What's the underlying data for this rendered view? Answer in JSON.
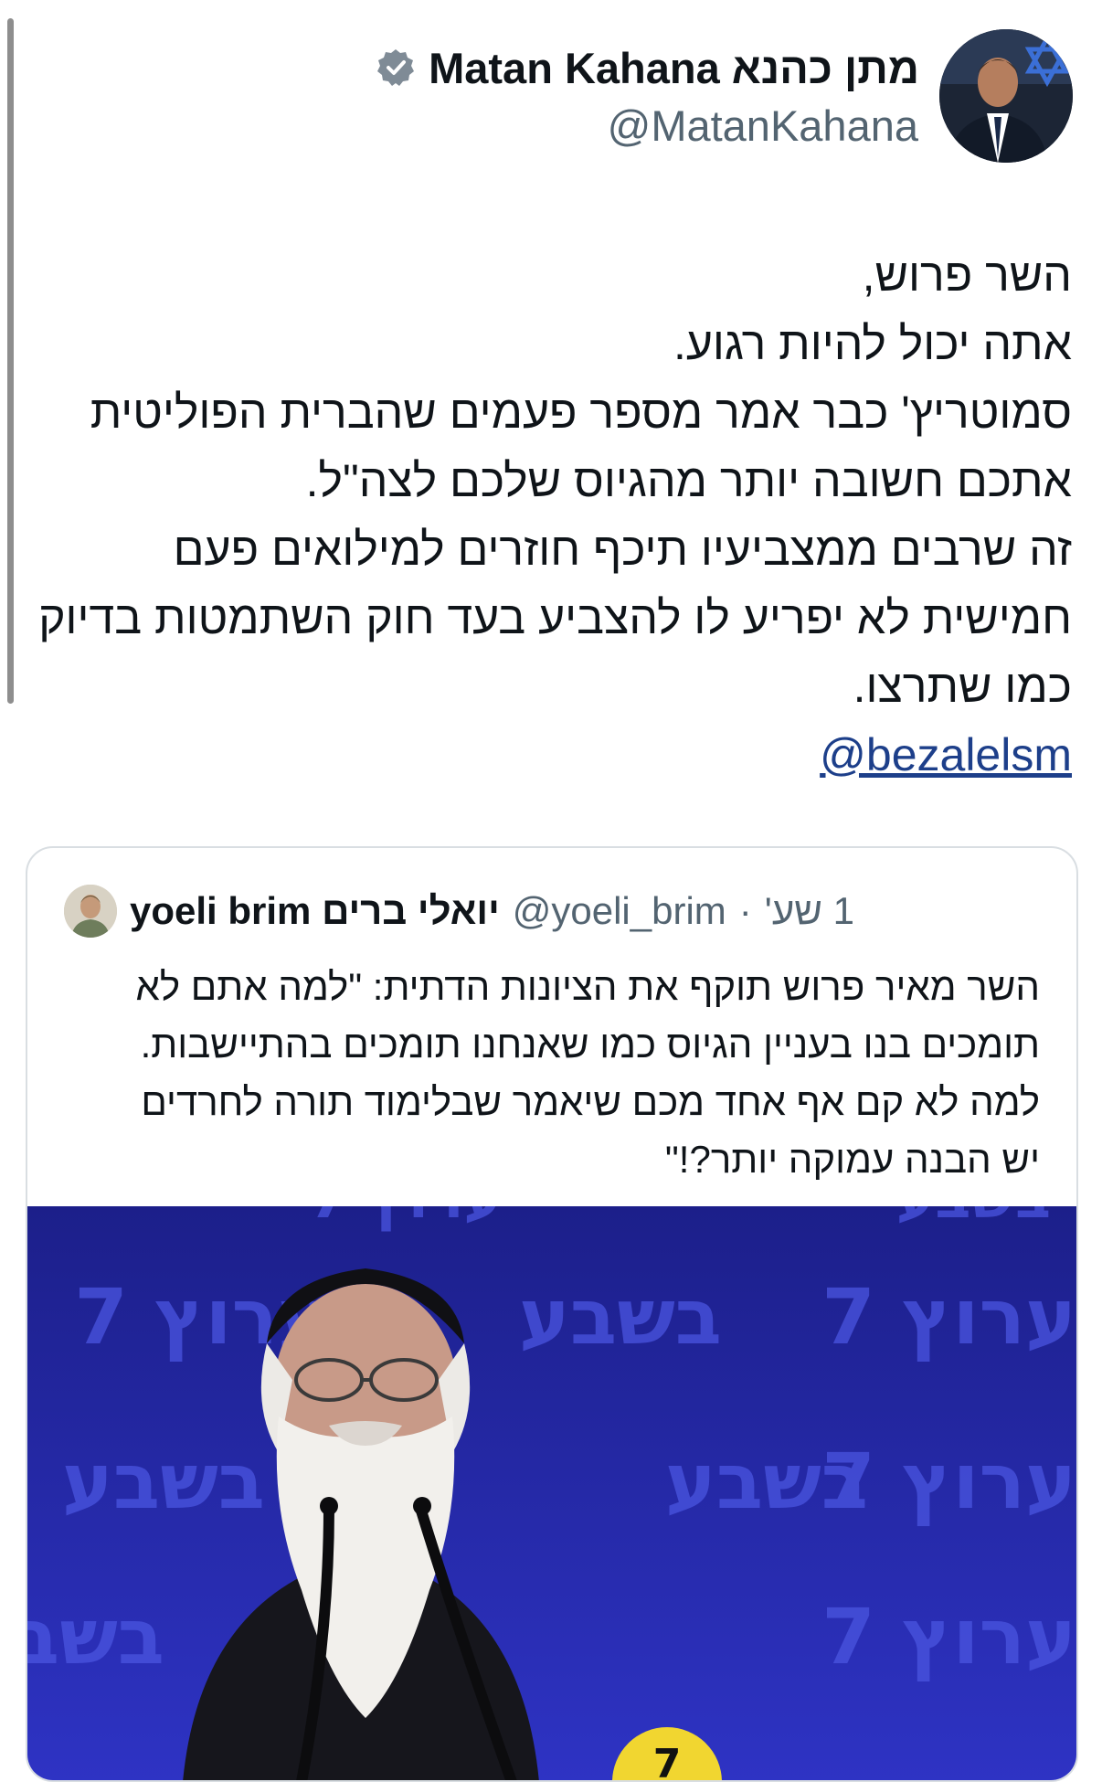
{
  "tweet": {
    "display_name": "Matan Kahana מתן כהנא",
    "handle": "@MatanKahana",
    "lines": [
      "השר פרוש,",
      "אתה יכול להיות רגוע.",
      "סמוטריץ' כבר אמר מספר פעמים שהברית הפוליטית",
      "אתכם חשובה יותר מהגיוס שלכם לצה\"ל.",
      "זה שרבים ממצביעיו תיכף חוזרים למילואים פעם",
      "חמישית לא יפריע לו להצביע בעד חוק השתמטות בדיוק",
      "כמו שתרצו."
    ],
    "mention": "@bezalelsm"
  },
  "quoted": {
    "display_name": "yoeli brim יואלי ברים",
    "handle": "@yoeli_brim",
    "separator": "·",
    "time": "1 שע'",
    "lines": [
      "השר מאיר פרוש תוקף את הציונות הדתית: \"למה אתם לא",
      "תומכים בנו בעניין הגיוס כמו שאנחנו תומכים בהתיישבות.",
      "למה לא קם אף אחד מכם שיאמר שבלימוד תורה לחרדים",
      "יש הבנה עמוקה יותר?!\""
    ],
    "image_backdrop_text": [
      "ערוץ 7",
      "בשבע"
    ]
  },
  "icons": {
    "verified": "verified-badge-icon",
    "flag": "israel-flag-icon"
  },
  "colors": {
    "text": "#0f1419",
    "secondary": "#536471",
    "link": "#1d3f8a",
    "backdrop": "#2a2fb8"
  }
}
